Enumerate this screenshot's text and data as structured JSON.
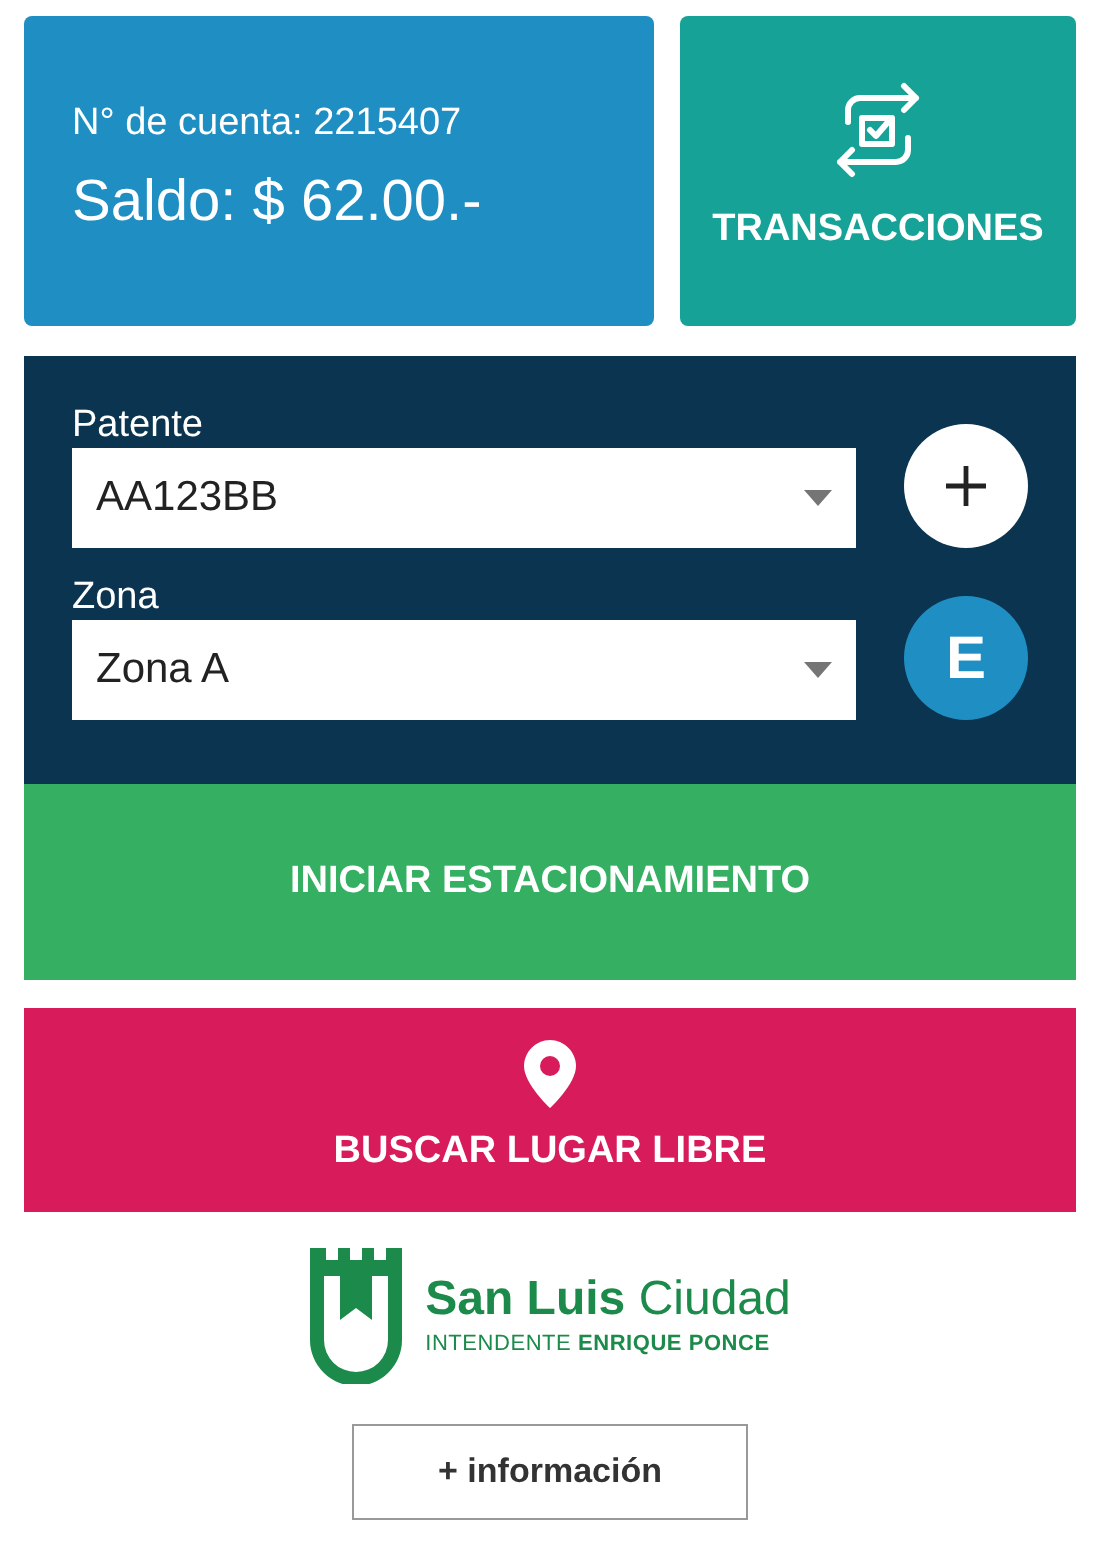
{
  "account": {
    "number_label": "N° de cuenta: 2215407",
    "balance": "Saldo: $ 62.00.-"
  },
  "transactions_button": {
    "label": "TRANSACCIONES"
  },
  "form": {
    "fields": [
      {
        "label": "Patente",
        "value": "AA123BB",
        "action": {
          "kind": "add"
        }
      },
      {
        "label": "Zona",
        "value": "Zona A",
        "action": {
          "kind": "text",
          "label": "E"
        }
      }
    ]
  },
  "start_button": {
    "label": "INICIAR ESTACIONAMIENTO"
  },
  "find_button": {
    "label": "BUSCAR LUGAR LIBRE"
  },
  "logo": {
    "name_bold": "San Luis",
    "name_light": "Ciudad",
    "subtitle": "INTENDENTE **ENRIQUE PONCE**"
  },
  "info_button": {
    "label": "+ información"
  }
}
